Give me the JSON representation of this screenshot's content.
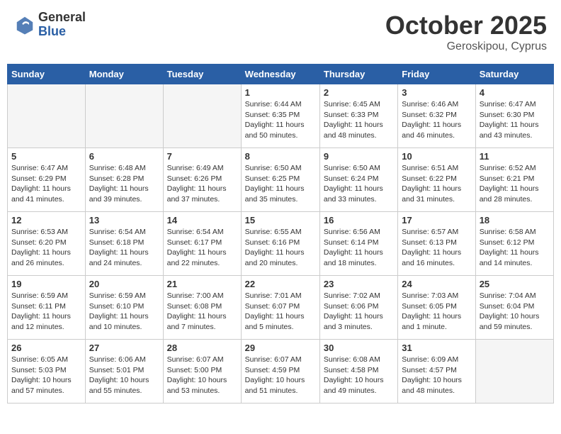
{
  "header": {
    "logo_general": "General",
    "logo_blue": "Blue",
    "month": "October 2025",
    "location": "Geroskipou, Cyprus"
  },
  "days_of_week": [
    "Sunday",
    "Monday",
    "Tuesday",
    "Wednesday",
    "Thursday",
    "Friday",
    "Saturday"
  ],
  "weeks": [
    [
      {
        "day": "",
        "info": ""
      },
      {
        "day": "",
        "info": ""
      },
      {
        "day": "",
        "info": ""
      },
      {
        "day": "1",
        "info": "Sunrise: 6:44 AM\nSunset: 6:35 PM\nDaylight: 11 hours\nand 50 minutes."
      },
      {
        "day": "2",
        "info": "Sunrise: 6:45 AM\nSunset: 6:33 PM\nDaylight: 11 hours\nand 48 minutes."
      },
      {
        "day": "3",
        "info": "Sunrise: 6:46 AM\nSunset: 6:32 PM\nDaylight: 11 hours\nand 46 minutes."
      },
      {
        "day": "4",
        "info": "Sunrise: 6:47 AM\nSunset: 6:30 PM\nDaylight: 11 hours\nand 43 minutes."
      }
    ],
    [
      {
        "day": "5",
        "info": "Sunrise: 6:47 AM\nSunset: 6:29 PM\nDaylight: 11 hours\nand 41 minutes."
      },
      {
        "day": "6",
        "info": "Sunrise: 6:48 AM\nSunset: 6:28 PM\nDaylight: 11 hours\nand 39 minutes."
      },
      {
        "day": "7",
        "info": "Sunrise: 6:49 AM\nSunset: 6:26 PM\nDaylight: 11 hours\nand 37 minutes."
      },
      {
        "day": "8",
        "info": "Sunrise: 6:50 AM\nSunset: 6:25 PM\nDaylight: 11 hours\nand 35 minutes."
      },
      {
        "day": "9",
        "info": "Sunrise: 6:50 AM\nSunset: 6:24 PM\nDaylight: 11 hours\nand 33 minutes."
      },
      {
        "day": "10",
        "info": "Sunrise: 6:51 AM\nSunset: 6:22 PM\nDaylight: 11 hours\nand 31 minutes."
      },
      {
        "day": "11",
        "info": "Sunrise: 6:52 AM\nSunset: 6:21 PM\nDaylight: 11 hours\nand 28 minutes."
      }
    ],
    [
      {
        "day": "12",
        "info": "Sunrise: 6:53 AM\nSunset: 6:20 PM\nDaylight: 11 hours\nand 26 minutes."
      },
      {
        "day": "13",
        "info": "Sunrise: 6:54 AM\nSunset: 6:18 PM\nDaylight: 11 hours\nand 24 minutes."
      },
      {
        "day": "14",
        "info": "Sunrise: 6:54 AM\nSunset: 6:17 PM\nDaylight: 11 hours\nand 22 minutes."
      },
      {
        "day": "15",
        "info": "Sunrise: 6:55 AM\nSunset: 6:16 PM\nDaylight: 11 hours\nand 20 minutes."
      },
      {
        "day": "16",
        "info": "Sunrise: 6:56 AM\nSunset: 6:14 PM\nDaylight: 11 hours\nand 18 minutes."
      },
      {
        "day": "17",
        "info": "Sunrise: 6:57 AM\nSunset: 6:13 PM\nDaylight: 11 hours\nand 16 minutes."
      },
      {
        "day": "18",
        "info": "Sunrise: 6:58 AM\nSunset: 6:12 PM\nDaylight: 11 hours\nand 14 minutes."
      }
    ],
    [
      {
        "day": "19",
        "info": "Sunrise: 6:59 AM\nSunset: 6:11 PM\nDaylight: 11 hours\nand 12 minutes."
      },
      {
        "day": "20",
        "info": "Sunrise: 6:59 AM\nSunset: 6:10 PM\nDaylight: 11 hours\nand 10 minutes."
      },
      {
        "day": "21",
        "info": "Sunrise: 7:00 AM\nSunset: 6:08 PM\nDaylight: 11 hours\nand 7 minutes."
      },
      {
        "day": "22",
        "info": "Sunrise: 7:01 AM\nSunset: 6:07 PM\nDaylight: 11 hours\nand 5 minutes."
      },
      {
        "day": "23",
        "info": "Sunrise: 7:02 AM\nSunset: 6:06 PM\nDaylight: 11 hours\nand 3 minutes."
      },
      {
        "day": "24",
        "info": "Sunrise: 7:03 AM\nSunset: 6:05 PM\nDaylight: 11 hours\nand 1 minute."
      },
      {
        "day": "25",
        "info": "Sunrise: 7:04 AM\nSunset: 6:04 PM\nDaylight: 10 hours\nand 59 minutes."
      }
    ],
    [
      {
        "day": "26",
        "info": "Sunrise: 6:05 AM\nSunset: 5:03 PM\nDaylight: 10 hours\nand 57 minutes."
      },
      {
        "day": "27",
        "info": "Sunrise: 6:06 AM\nSunset: 5:01 PM\nDaylight: 10 hours\nand 55 minutes."
      },
      {
        "day": "28",
        "info": "Sunrise: 6:07 AM\nSunset: 5:00 PM\nDaylight: 10 hours\nand 53 minutes."
      },
      {
        "day": "29",
        "info": "Sunrise: 6:07 AM\nSunset: 4:59 PM\nDaylight: 10 hours\nand 51 minutes."
      },
      {
        "day": "30",
        "info": "Sunrise: 6:08 AM\nSunset: 4:58 PM\nDaylight: 10 hours\nand 49 minutes."
      },
      {
        "day": "31",
        "info": "Sunrise: 6:09 AM\nSunset: 4:57 PM\nDaylight: 10 hours\nand 48 minutes."
      },
      {
        "day": "",
        "info": ""
      }
    ]
  ]
}
